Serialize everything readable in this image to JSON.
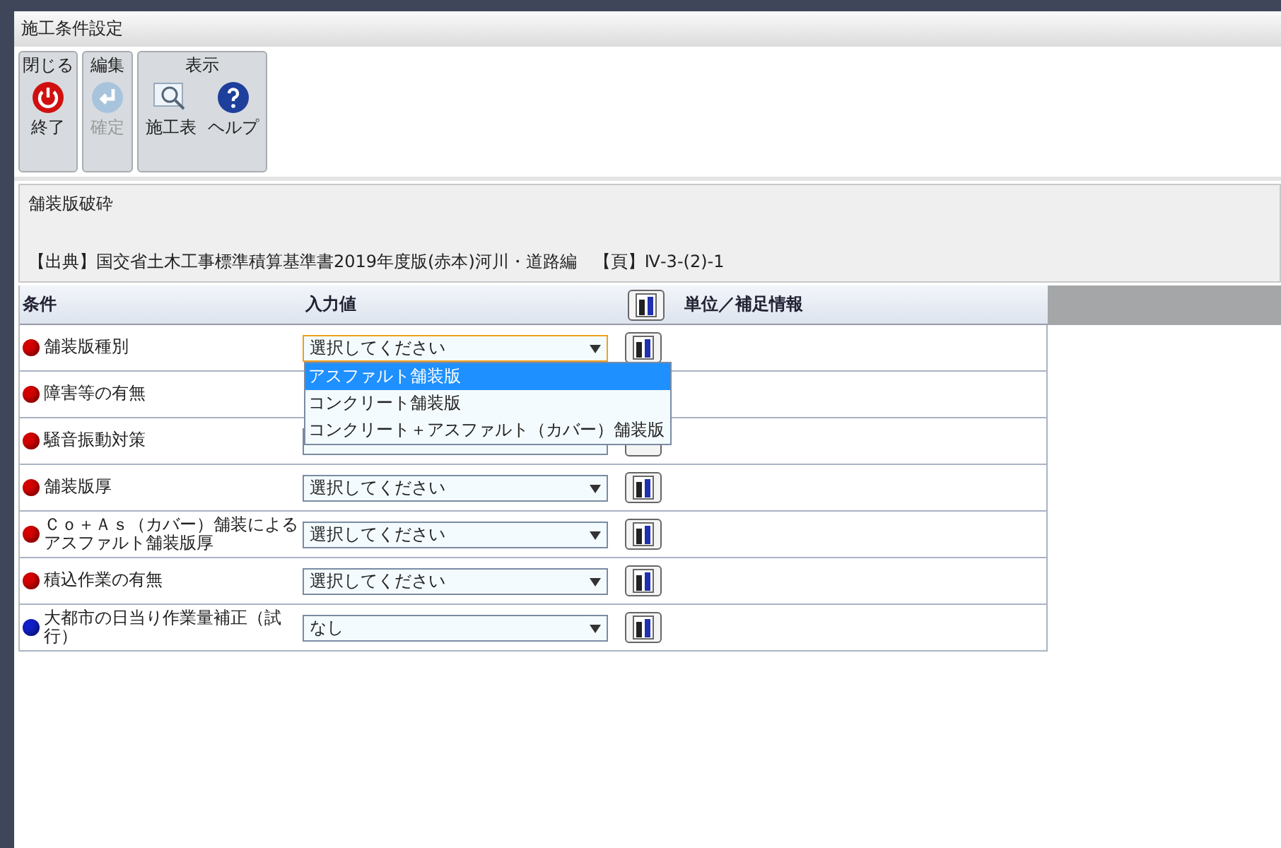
{
  "window": {
    "title": "施工条件設定"
  },
  "toolbar": [
    {
      "label": "閉じる",
      "buttons": [
        {
          "kind": "power",
          "label": "終了",
          "disabled": false
        }
      ]
    },
    {
      "label": "編集",
      "buttons": [
        {
          "kind": "enter",
          "label": "確定",
          "disabled": true
        }
      ]
    },
    {
      "label": "表示",
      "buttons": [
        {
          "kind": "table",
          "label": "施工表",
          "disabled": false
        },
        {
          "kind": "help",
          "label": "ヘルプ",
          "disabled": false
        }
      ]
    }
  ],
  "info": {
    "title": "舗装版破砕",
    "source": "【出典】国交省土木工事標準積算基準書2019年度版(赤本)河川・道路編　【頁】Ⅳ-3-(2)-1"
  },
  "table": {
    "columns": [
      "条件",
      "入力値",
      "単位／補足情報"
    ],
    "rows": [
      {
        "kind": "select",
        "label": "舗装版種別",
        "color": "#d40000",
        "value": "選択してください",
        "focused": true
      },
      {
        "kind": "covered",
        "label": "障害等の有無",
        "color": "#d40000"
      },
      {
        "kind": "partial",
        "label": "騒音振動対策",
        "color": "#d40000"
      },
      {
        "kind": "select",
        "label": "舗装版厚",
        "color": "#d40000",
        "value": "選択してください",
        "focused": false
      },
      {
        "kind": "select",
        "label": "Ｃｏ＋Ａｓ（カバー）舗装によるアスファルト舗装版厚",
        "color": "#d40000",
        "value": "選択してください",
        "focused": false
      },
      {
        "kind": "select",
        "label": "積込作業の有無",
        "color": "#d40000",
        "value": "選択してください",
        "focused": false
      },
      {
        "kind": "select",
        "label": "大都市の日当り作業量補正（試行）",
        "color": "#1020c8",
        "value": "なし",
        "focused": false
      }
    ]
  },
  "dropdown": {
    "options": [
      {
        "label": "アスファルト舗装版",
        "selected": true
      },
      {
        "label": "コンクリート舗装版",
        "selected": false
      },
      {
        "label": "コンクリート＋アスファルト（カバー）舗装版",
        "selected": false
      }
    ]
  }
}
